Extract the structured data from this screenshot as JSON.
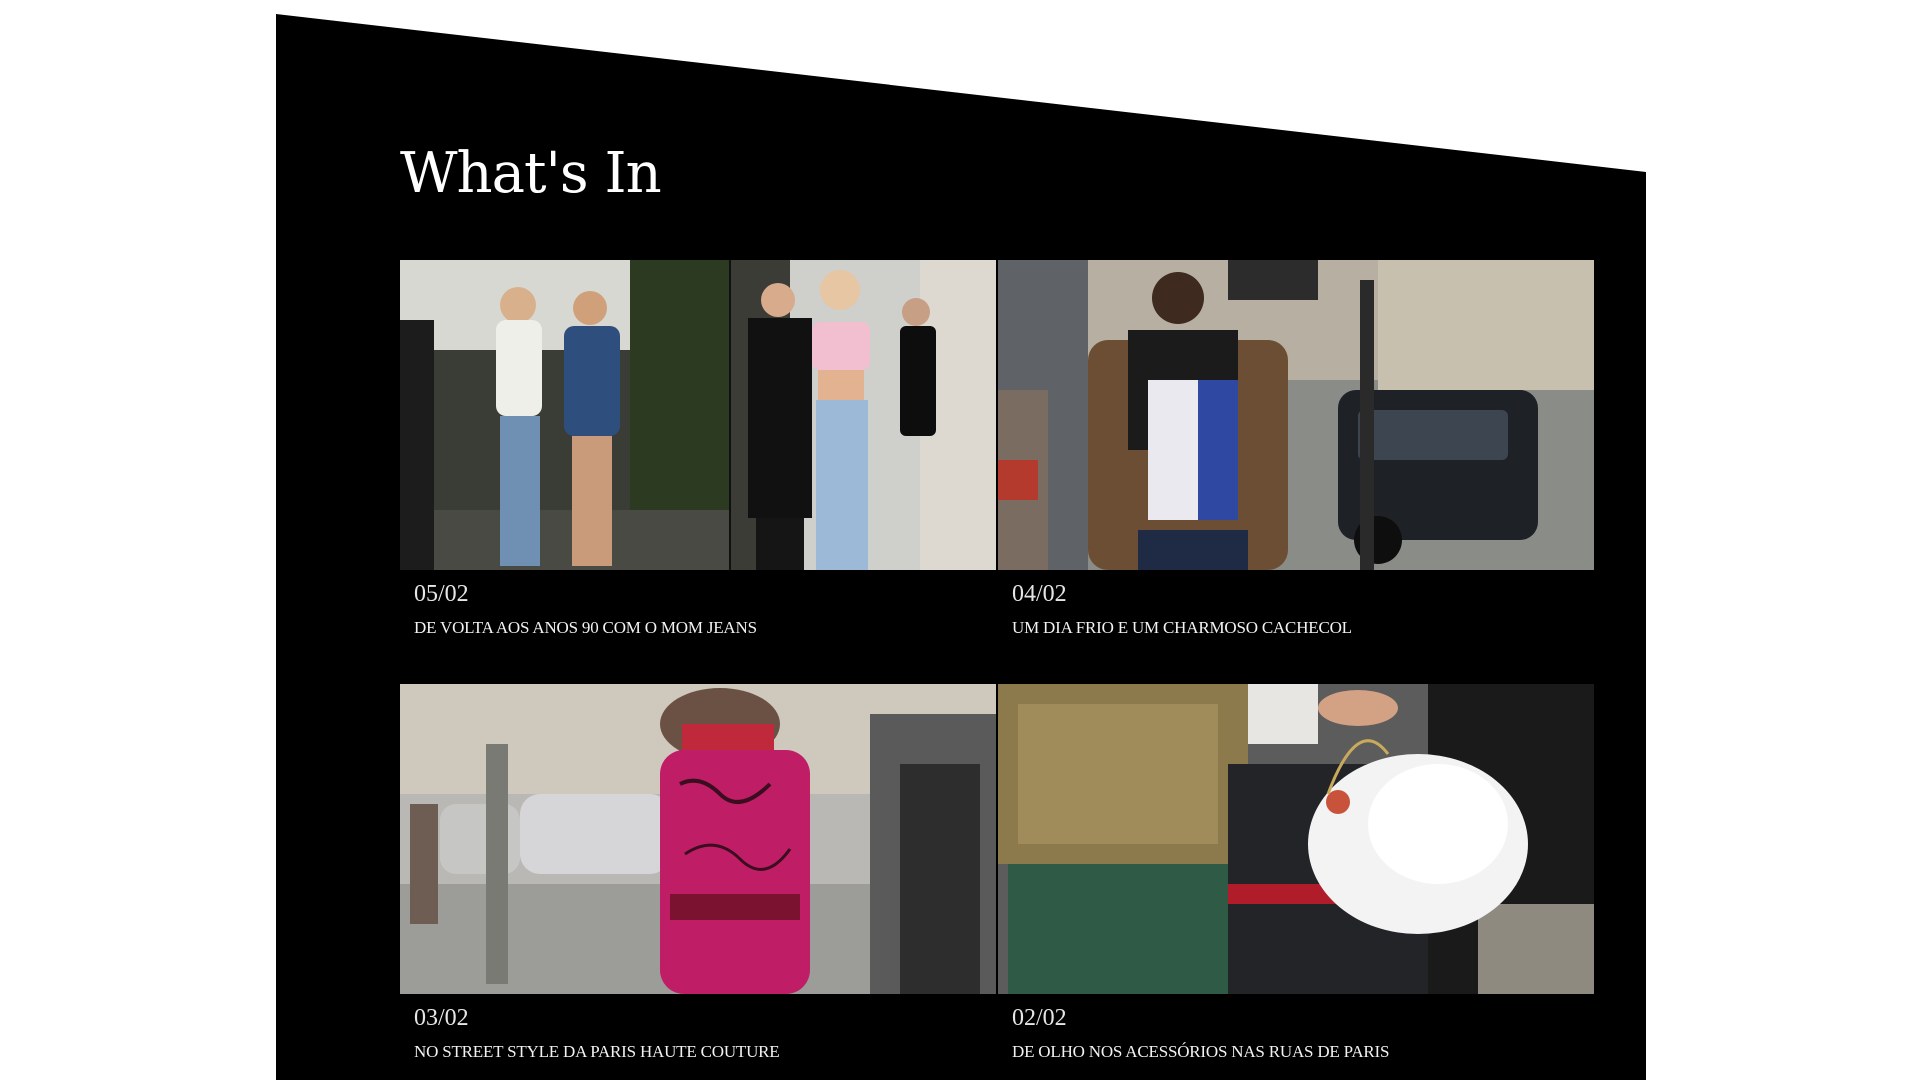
{
  "section": {
    "title": "What's In"
  },
  "posts": [
    {
      "date": "05/02",
      "caption": "DE VOLTA AOS ANOS 90 COM O MOM JEANS",
      "image": "two-women-event-photo-and-woman-in-pink-crop-top"
    },
    {
      "date": "04/02",
      "caption": "UM DIA FRIO E UM CHARMOSO CACHECOL",
      "image": "street-style-woman-with-scarf-and-fur-coat"
    },
    {
      "date": "03/02",
      "caption": "NO STREET STYLE DA PARIS HAUTE COUTURE",
      "image": "woman-in-pink-artists-trench-coat"
    },
    {
      "date": "02/02",
      "caption": "DE OLHO NOS ACESSÓRIOS NAS RUAS DE PARIS",
      "image": "gold-jacket-and-white-feather-bag"
    }
  ],
  "colors": {
    "panel": "#000000",
    "background": "#ffffff",
    "text": "#ffffff"
  }
}
